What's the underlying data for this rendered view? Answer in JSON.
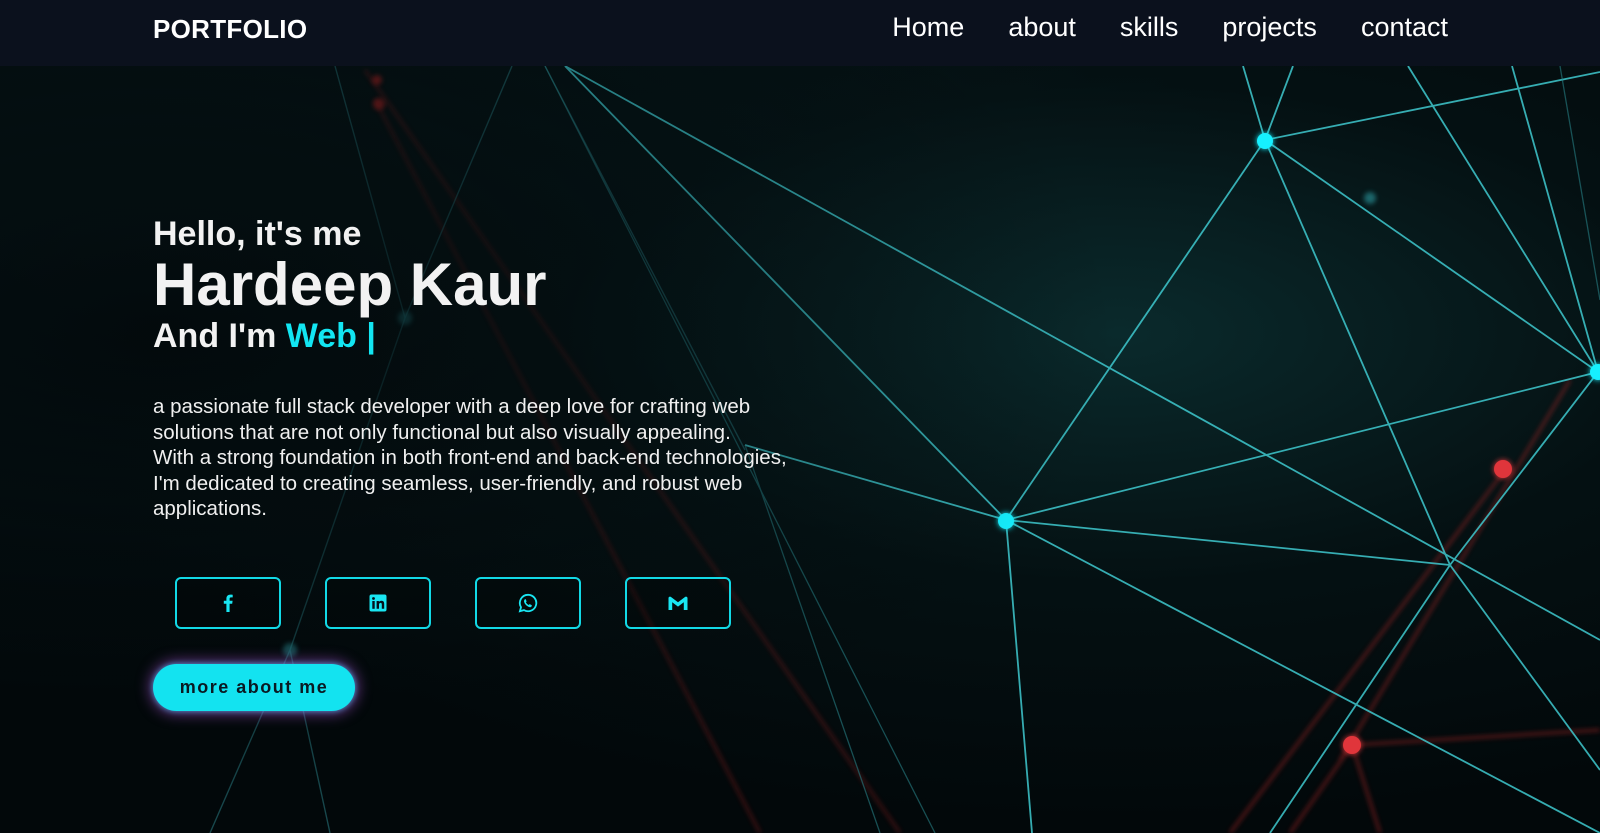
{
  "brand": {
    "logo": "PORTFOLIO"
  },
  "nav": {
    "items": [
      {
        "label": "Home"
      },
      {
        "label": "about"
      },
      {
        "label": "skills"
      },
      {
        "label": "projects"
      },
      {
        "label": "contact"
      }
    ]
  },
  "hero": {
    "greeting": "Hello, it's me",
    "name": "Hardeep Kaur",
    "role_prefix": "And I'm ",
    "role_typed": "Web |",
    "bio": {
      "line1": "a passionate full stack developer with a deep love for crafting web solutions that are not only functional but also visually appealing.",
      "line2": "With a strong foundation in both front-end and back-end technologies,",
      "line3": "I'm dedicated to creating seamless, user-friendly, and robust web applications."
    },
    "cta_label": "more about me"
  },
  "socials": [
    {
      "icon": "facebook-icon"
    },
    {
      "icon": "linkedin-icon"
    },
    {
      "icon": "whatsapp-icon"
    },
    {
      "icon": "gmail-icon"
    }
  ],
  "colors": {
    "accent": "#12e6f2",
    "navbar": "#0b111d",
    "background": "#02080a",
    "network_red": "#d42a2a"
  }
}
